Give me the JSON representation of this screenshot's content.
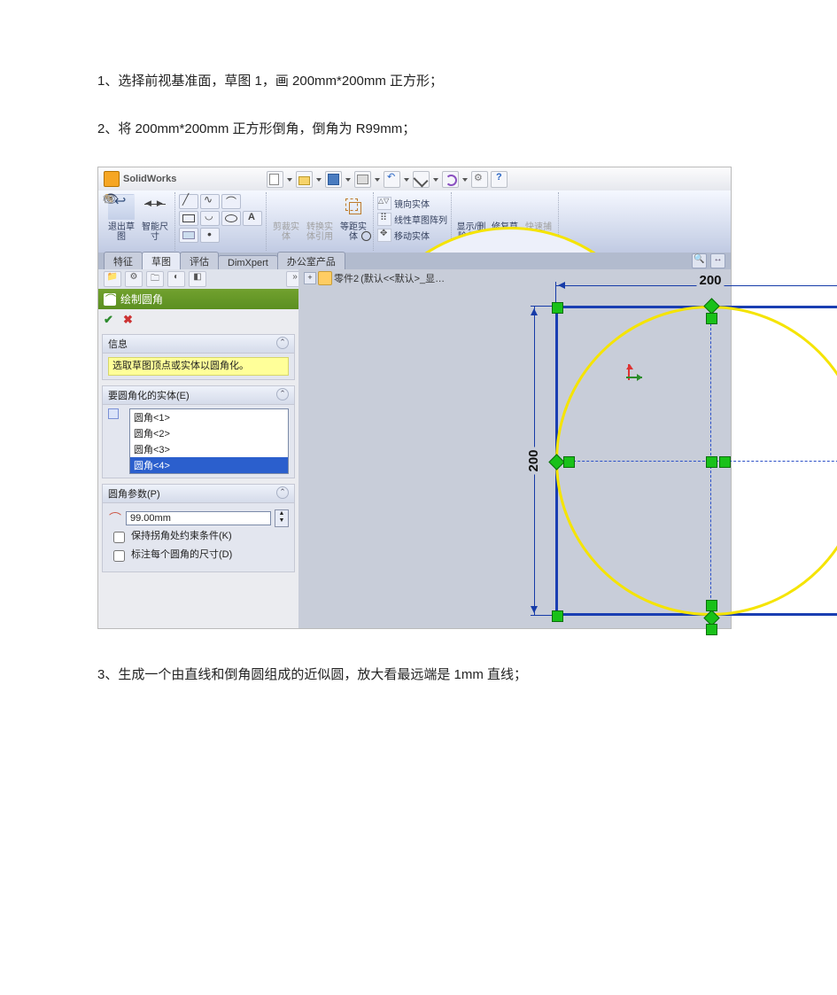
{
  "instructions": {
    "step1": "1、选择前视基准面，草图 1，画 200mm*200mm 正方形；",
    "step2": "2、将 200mm*200mm 正方形倒角，倒角为 R99mm；",
    "step3": "3、生成一个由直线和倒角圆组成的近似圆，放大看最远端是 1mm 直线；"
  },
  "app": {
    "title": "SolidWorks"
  },
  "tabs": {
    "t1": "特征",
    "t2": "草图",
    "t3": "评估",
    "t4": "DimXpert",
    "t5": "办公室产品"
  },
  "ribbon": {
    "exit_sketch": "退出草图",
    "smart_dim": "智能尺寸",
    "trim": "剪裁实体",
    "convert": "转换实体引用",
    "offset": "等距实体",
    "mirror": "镜向实体",
    "linear_pattern": "线性草图阵列",
    "move": "移动实体",
    "display": "显示/删除几…",
    "repair": "修复草图",
    "snap": "快速捕捉"
  },
  "doc_tab": {
    "part": "零件2",
    "config": "(默认<<默认>_显…"
  },
  "pm": {
    "title": "绘制圆角",
    "info_section": "信息",
    "info_msg": "选取草图顶点或实体以圆角化。",
    "entities_section": "要圆角化的实体(E)",
    "items": {
      "a": "圆角<1>",
      "b": "圆角<2>",
      "c": "圆角<3>",
      "d": "圆角<4>"
    },
    "params_section": "圆角参数(P)",
    "radius": "99.00mm",
    "keep_constraint": "保持拐角处约束条件(K)",
    "dim_each": "标注每个圆角的尺寸(D)"
  },
  "dims": {
    "w": "200",
    "h": "200"
  }
}
